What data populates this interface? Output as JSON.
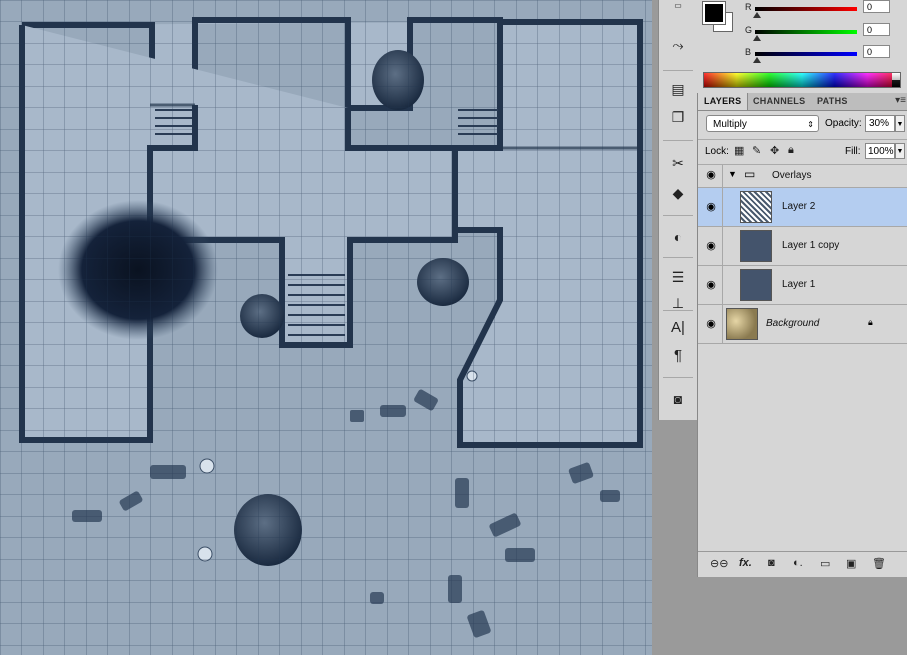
{
  "canvas": {
    "grid": "on",
    "grid_color": "#1f3550",
    "map_tint": "#6f8499"
  },
  "toolbar": {
    "tools": [
      {
        "icon": "history-brush-icon"
      },
      {
        "icon": "notes-icon"
      },
      {
        "icon": "clone-source-icon"
      },
      {
        "icon": "tools-icon"
      },
      {
        "icon": "3d-icon"
      },
      {
        "icon": "adjustments-icon"
      },
      {
        "icon": "styles-icon"
      },
      {
        "icon": "stamp-icon"
      },
      {
        "icon": "character-icon"
      },
      {
        "icon": "paragraph-icon"
      },
      {
        "icon": "mask-icon"
      }
    ]
  },
  "color": {
    "foreground": "#000000",
    "background": "#ffffff",
    "channels": [
      {
        "label": "R",
        "value": "0",
        "color": "#cc0000"
      },
      {
        "label": "G",
        "value": "0",
        "color": "#00aa00"
      },
      {
        "label": "B",
        "value": "0",
        "color": "#0000cc"
      }
    ]
  },
  "layers_panel": {
    "tabs": [
      "LAYERS",
      "CHANNELS",
      "PATHS"
    ],
    "blend_mode": "Multiply",
    "opacity_label": "Opacity:",
    "opacity_value": "30%",
    "lock_label": "Lock:",
    "fill_label": "Fill:",
    "fill_value": "100%",
    "layers": [
      {
        "name": "Overlays",
        "type": "group"
      },
      {
        "name": "Layer 2",
        "type": "layer",
        "selected": true
      },
      {
        "name": "Layer 1 copy",
        "type": "layer"
      },
      {
        "name": "Layer 1",
        "type": "layer"
      },
      {
        "name": "Background",
        "type": "background",
        "locked": true
      }
    ]
  },
  "bottom_icons": [
    "link-icon",
    "fx-icon",
    "add-mask-icon",
    "adjustment-layer-icon",
    "new-group-icon",
    "new-layer-icon",
    "trash-icon"
  ]
}
